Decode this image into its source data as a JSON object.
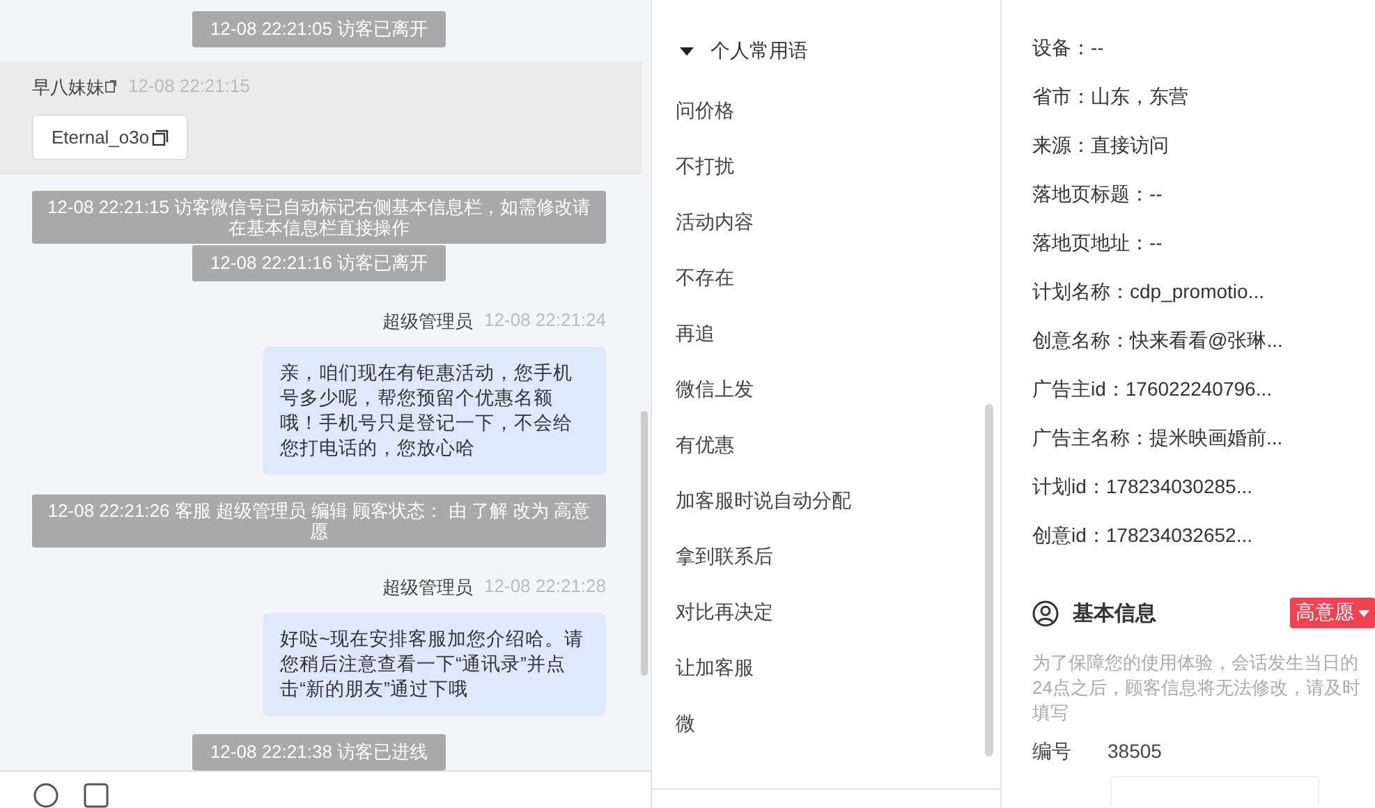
{
  "chat": {
    "messages": [
      {
        "kind": "system",
        "text": "12-08 22:21:05 访客已离开"
      },
      {
        "kind": "visitor",
        "sender": "早八妹妹",
        "time": "12-08 22:21:15",
        "text": "Eternal_o3o"
      },
      {
        "kind": "system",
        "text": "12-08 22:21:15 访客微信号已自动标记右侧基本信息栏，如需修改请在基本信息栏直接操作"
      },
      {
        "kind": "system",
        "text": "12-08 22:21:16 访客已离开"
      },
      {
        "kind": "agent",
        "sender": "超级管理员",
        "time": "12-08 22:21:24",
        "text": "亲，咱们现在有钜惠活动，您手机号多少呢，帮您预留个优惠名额哦！手机号只是登记一下，不会给您打电话的，您放心哈"
      },
      {
        "kind": "system",
        "text": "12-08 22:21:26 客服 超级管理员 编辑 顾客状态： 由 了解 改为 高意愿"
      },
      {
        "kind": "agent",
        "sender": "超级管理员",
        "time": "12-08 22:21:28",
        "text": "好哒~现在安排客服加您介绍哈。请您稍后注意查看一下“通讯录”并点击“新的朋友”通过下哦"
      },
      {
        "kind": "system",
        "text": "12-08 22:21:38 访客已进线"
      }
    ]
  },
  "phrases": {
    "group": {
      "title": "个人常用语",
      "expanded": true
    },
    "items": [
      "问价格",
      "不打扰",
      "活动内容",
      "不存在",
      "再追",
      "微信上发",
      "有优惠",
      "加客服时说自动分配",
      "拿到联系后",
      "对比再决定",
      "让加客服",
      "微"
    ]
  },
  "source_info": {
    "fields": [
      "设备：--",
      "省市：山东，东营",
      "来源：直接访问",
      "落地页标题：--",
      "落地页地址：--",
      "计划名称：cdp_promotio...",
      "创意名称：快来看看@张琳...",
      "广告主id：176022240796...",
      "广告主名称：提米映画婚前...",
      "计划id：178234030285...",
      "创意id：178234032652..."
    ]
  },
  "basic_info": {
    "title": "基本信息",
    "intent": "高意愿",
    "note": "为了保障您的使用体验，会话发生当日的24点之后，顾客信息将无法修改，请及时填写",
    "number_label": "编号",
    "number": "38505"
  }
}
